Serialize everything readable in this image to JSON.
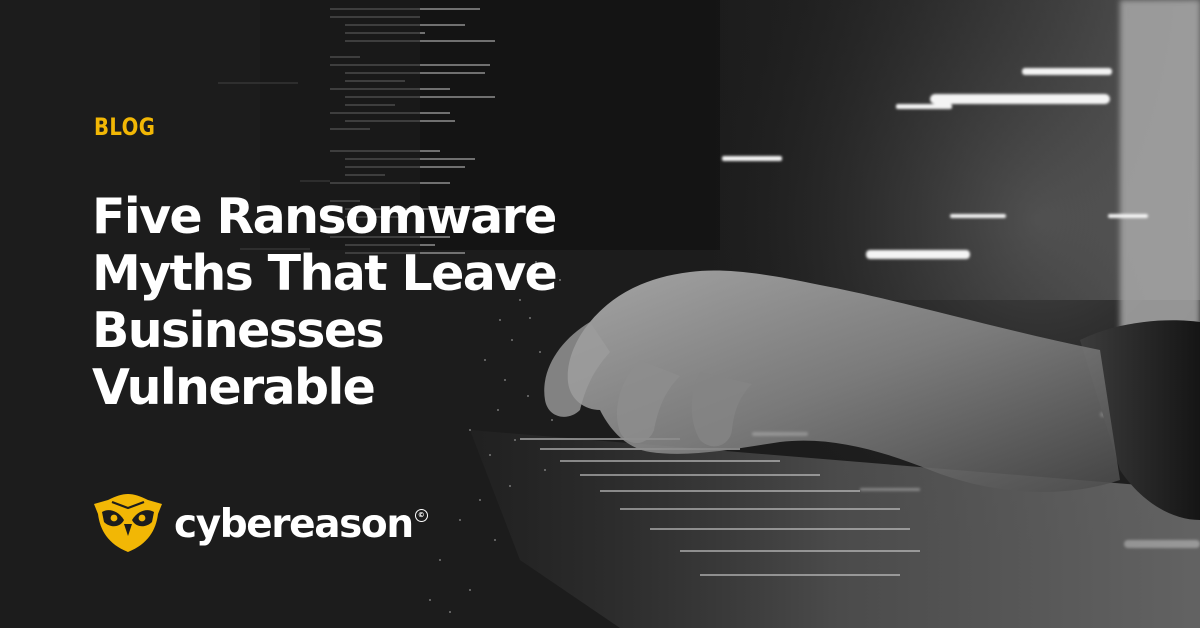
{
  "post": {
    "category": "BLOG",
    "title_lines": [
      "Five Ransomware",
      "Myths That Leave",
      "Businesses",
      "Vulnerable"
    ]
  },
  "brand": {
    "name": "cybereason",
    "logo_icon": "owl-icon",
    "accent_color": "#f2b705"
  },
  "background": {
    "image_icon": "hands-typing-laptop-photo",
    "palette": [
      "#1d1d1d",
      "#9a9a9a",
      "#ffffff"
    ]
  }
}
